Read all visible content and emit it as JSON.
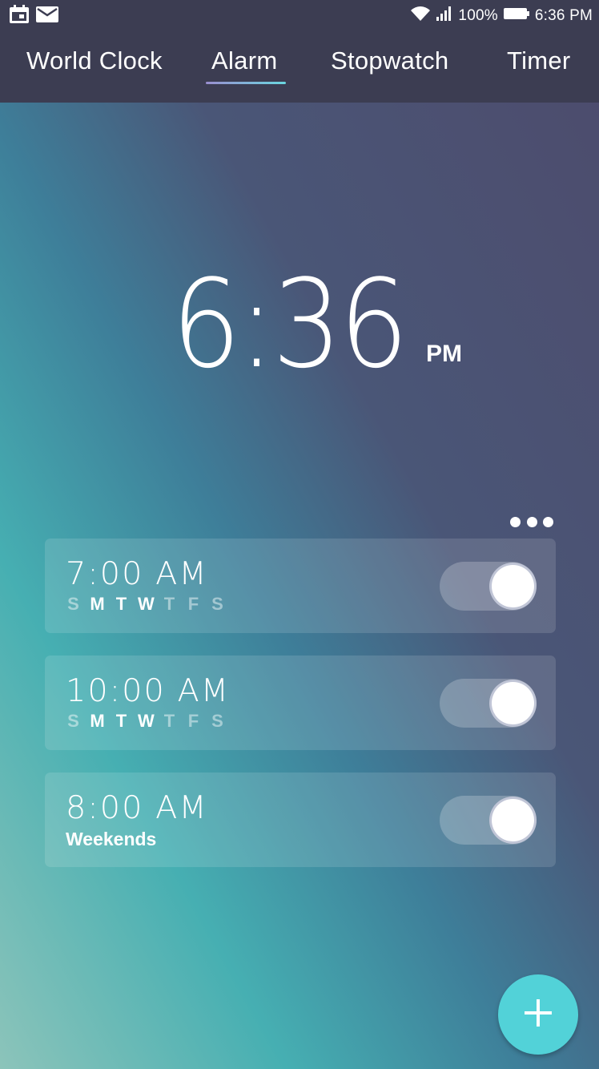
{
  "status_bar": {
    "battery": "100%",
    "time": "6:36 PM",
    "icons": [
      "calendar-icon",
      "mail-icon",
      "wifi-icon",
      "signal-icon",
      "battery-icon"
    ]
  },
  "tabs": [
    {
      "label": "World Clock",
      "active": false
    },
    {
      "label": "Alarm",
      "active": true
    },
    {
      "label": "Stopwatch",
      "active": false
    },
    {
      "label": "Timer",
      "active": false
    }
  ],
  "clock": {
    "time": "6:36",
    "ampm": "PM"
  },
  "alarms": [
    {
      "time": "7:00 AM",
      "days": [
        "S",
        "M",
        "T",
        "W",
        "T",
        "F",
        "S"
      ],
      "days_active": [
        false,
        true,
        true,
        true,
        false,
        false,
        false
      ],
      "enabled": true
    },
    {
      "time": "10:00 AM",
      "days": [
        "S",
        "M",
        "T",
        "W",
        "T",
        "F",
        "S"
      ],
      "days_active": [
        false,
        true,
        true,
        true,
        false,
        false,
        false
      ],
      "enabled": true
    },
    {
      "time": "8:00 AM",
      "label": "Weekends",
      "enabled": true
    }
  ],
  "colors": {
    "bar": "#3c3d52",
    "accent": "#52d2d8"
  }
}
